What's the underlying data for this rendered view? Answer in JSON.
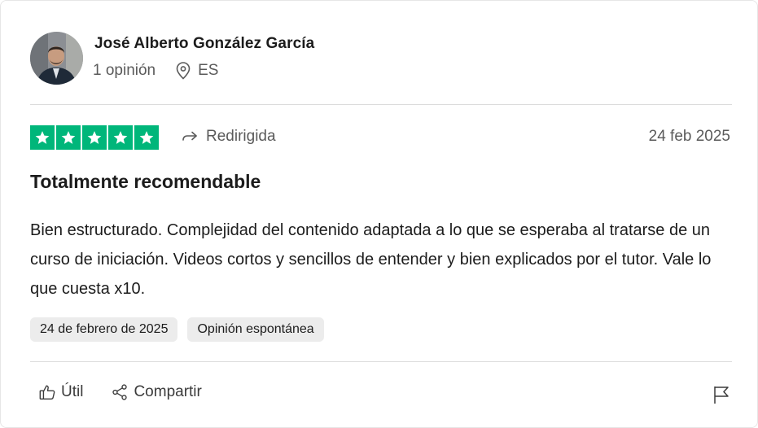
{
  "reviewer": {
    "name": "José Alberto González García",
    "review_count": "1 opinión",
    "country": "ES"
  },
  "rating": {
    "stars": 5,
    "max_stars": 5,
    "color": "#00b67a"
  },
  "redirected_label": "Redirigida",
  "date_short": "24 feb 2025",
  "review": {
    "title": "Totalmente recomendable",
    "body": "Bien estructurado. Complejidad del contenido adaptada a lo que se esperaba al tratarse de un curso de iniciación. Videos cortos y sencillos de entender y bien explicados por el tutor. Vale lo que cuesta x10."
  },
  "tags": {
    "experience_date": "24 de febrero de 2025",
    "review_type": "Opinión espontánea"
  },
  "actions": {
    "useful": "Útil",
    "share": "Compartir"
  },
  "icons": {
    "location": "location-pin-icon",
    "redirect": "redirect-arrow-icon",
    "useful": "thumbs-up-icon",
    "share": "share-icon",
    "report": "flag-icon"
  }
}
